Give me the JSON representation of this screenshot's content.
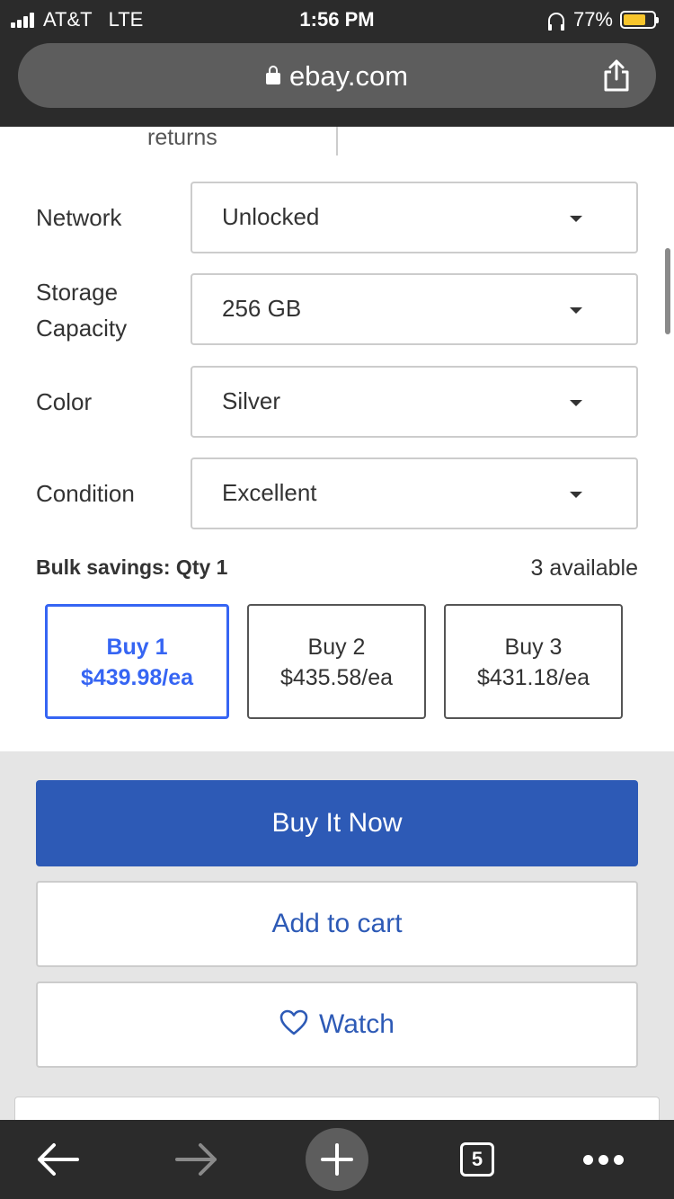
{
  "status_bar": {
    "carrier": "AT&T",
    "network": "LTE",
    "time": "1:56 PM",
    "battery": "77%",
    "battery_level": 0.77
  },
  "browser": {
    "url": "ebay.com",
    "tab_count": "5"
  },
  "peek": {
    "returns_text": "returns"
  },
  "options": [
    {
      "label": "Network",
      "value": "Unlocked"
    },
    {
      "label_line1": "Storage",
      "label_line2": "Capacity",
      "value": "256 GB"
    },
    {
      "label": "Color",
      "value": "Silver"
    },
    {
      "label": "Condition",
      "value": "Excellent"
    }
  ],
  "bulk": {
    "title": "Bulk savings: Qty 1",
    "available": "3 available",
    "tiers": [
      {
        "qty": "Buy 1",
        "price": "$439.98/ea",
        "selected": true
      },
      {
        "qty": "Buy 2",
        "price": "$435.58/ea",
        "selected": false
      },
      {
        "qty": "Buy 3",
        "price": "$431.18/ea",
        "selected": false
      }
    ]
  },
  "actions": {
    "buy_now": "Buy It Now",
    "add_to_cart": "Add to cart",
    "watch": "Watch"
  },
  "colors": {
    "primary": "#2d5ab6",
    "selected_tier": "#3665f3",
    "chrome": "#2b2b2b",
    "battery": "#f7c52c"
  },
  "icons": [
    "signal-icon",
    "headphones-icon",
    "battery-icon",
    "lock-icon",
    "share-icon",
    "caret-down-icon",
    "heart-icon",
    "back-arrow-icon",
    "forward-arrow-icon",
    "new-tab-plus-icon",
    "tabs-icon",
    "more-dots-icon"
  ]
}
